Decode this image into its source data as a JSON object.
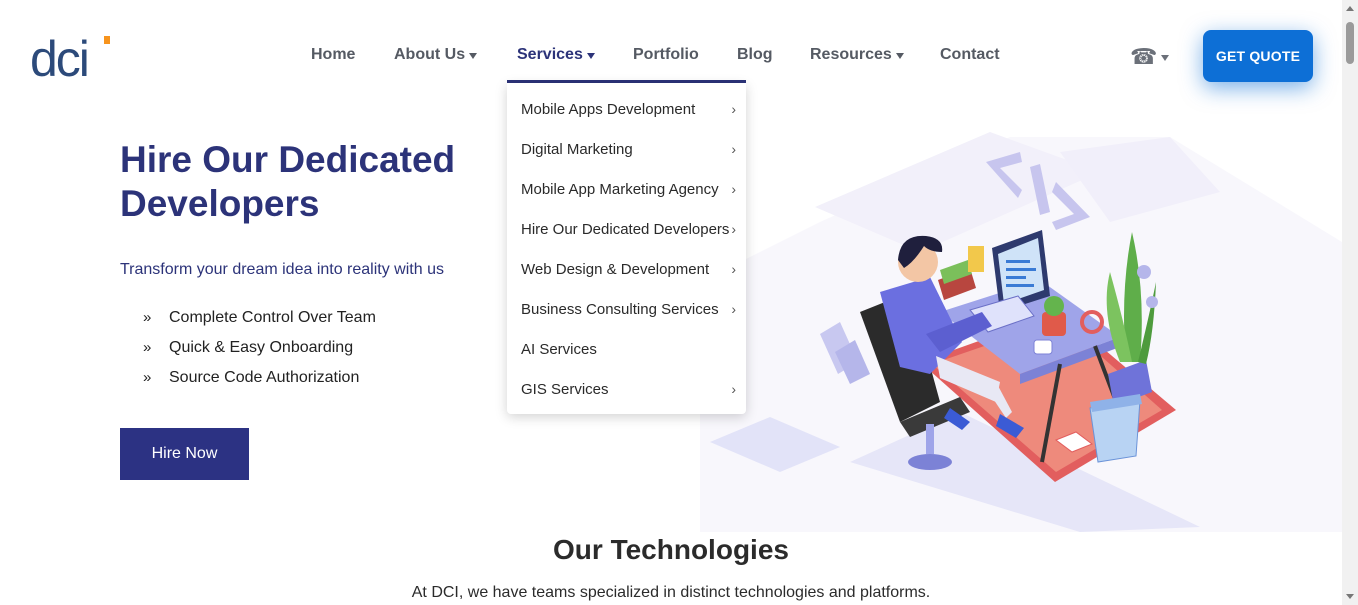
{
  "header": {
    "logo_text": "dci",
    "nav": [
      {
        "label": "Home",
        "has_caret": false
      },
      {
        "label": "About Us",
        "has_caret": true
      },
      {
        "label": "Services",
        "has_caret": true,
        "active": true
      },
      {
        "label": "Portfolio",
        "has_caret": false
      },
      {
        "label": "Blog",
        "has_caret": false
      },
      {
        "label": "Resources",
        "has_caret": true
      },
      {
        "label": "Contact",
        "has_caret": false
      }
    ],
    "phone_icon": "☎",
    "cta_label": "GET QUOTE"
  },
  "services_menu": [
    {
      "label": "Mobile Apps Development",
      "has_submenu": true
    },
    {
      "label": "Digital Marketing",
      "has_submenu": true
    },
    {
      "label": "Mobile App Marketing Agency",
      "has_submenu": true
    },
    {
      "label": "Hire Our Dedicated Developers",
      "has_submenu": true
    },
    {
      "label": "Web Design & Development",
      "has_submenu": true
    },
    {
      "label": "Business Consulting Services",
      "has_submenu": true
    },
    {
      "label": "AI Services",
      "has_submenu": false
    },
    {
      "label": "GIS Services",
      "has_submenu": true
    }
  ],
  "hero": {
    "title": "Hire Our Dedicated Developers",
    "subtitle": "Transform your dream idea into reality with us",
    "features": [
      "Complete Control Over Team",
      "Quick & Easy Onboarding",
      "Source Code Authorization"
    ],
    "bullet_glyph": "»",
    "button_label": "Hire Now"
  },
  "technologies": {
    "title": "Our Technologies",
    "description": "At DCI, we have teams specialized in distinct technologies and platforms."
  },
  "colors": {
    "brand_navy": "#2c3379",
    "cta_blue": "#0d6fd6",
    "logo_accent": "#f7941d"
  }
}
